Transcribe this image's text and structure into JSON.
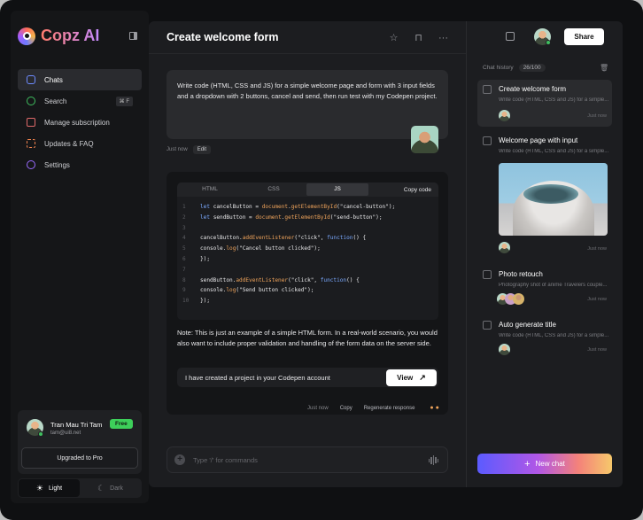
{
  "app": {
    "name": "Copz AI"
  },
  "nav": [
    {
      "label": "Chats",
      "icon": "chat-icon",
      "color": "#6d8bff"
    },
    {
      "label": "Search",
      "icon": "search-icon",
      "color": "#3fbf5f",
      "shortcut": "⌘ F"
    },
    {
      "label": "Manage subscription",
      "icon": "card-icon",
      "color": "#e06a6a"
    },
    {
      "label": "Updates & FAQ",
      "icon": "bulb-icon",
      "color": "#f0834e"
    },
    {
      "label": "Settings",
      "icon": "gear-icon",
      "color": "#9a6bff"
    }
  ],
  "user": {
    "name": "Tran Mau Tri Tam",
    "email": "tam@ui8.net",
    "plan": "Free",
    "upgrade_label": "Upgraded to Pro"
  },
  "theme": {
    "light": "Light",
    "dark": "Dark"
  },
  "chat": {
    "title": "Create welcome form",
    "prompt": "Write code (HTML, CSS and JS) for a simple welcome page and form with 3 input fields and a dropdown with 2 buttons, cancel and send, then run test with my Codepen project.",
    "prompt_time": "Just now",
    "edit_label": "Edit",
    "tabs": [
      "HTML",
      "CSS",
      "JS"
    ],
    "copy_code": "Copy code",
    "note": "Note: This is just an example of a simple HTML form. In a real-world scenario, you would also want to include proper validation and handling of the form data on the server side.",
    "project_text": "I have created a project in your Codepen account",
    "view_label": "View",
    "answer_time": "Just now",
    "copy_label": "Copy",
    "regen_label": "Regenerate response",
    "input_placeholder": "Type '/' for commands"
  },
  "code_lines": [
    {
      "n": "1",
      "parts": [
        [
          "kw",
          "let "
        ],
        [
          "tx",
          "cancelButton = "
        ],
        [
          "fn",
          "document"
        ],
        [
          "tx",
          "."
        ],
        [
          "fn",
          "getElementById"
        ],
        [
          "tx",
          "(\"cancel-button\");"
        ]
      ]
    },
    {
      "n": "2",
      "parts": [
        [
          "kw",
          "let "
        ],
        [
          "tx",
          "sendButton = "
        ],
        [
          "fn",
          "document"
        ],
        [
          "tx",
          "."
        ],
        [
          "fn",
          "getElementById"
        ],
        [
          "tx",
          "(\"send-button\");"
        ]
      ]
    },
    {
      "n": "3",
      "parts": []
    },
    {
      "n": "4",
      "parts": [
        [
          "tx",
          "cancelButton."
        ],
        [
          "fn",
          "addEventListener"
        ],
        [
          "tx",
          "(\"click\", "
        ],
        [
          "kw",
          "function"
        ],
        [
          "tx",
          "() {"
        ]
      ]
    },
    {
      "n": "5",
      "parts": [
        [
          "tx",
          "console."
        ],
        [
          "fn",
          "log"
        ],
        [
          "tx",
          "(\"Cancel button clicked\");"
        ]
      ]
    },
    {
      "n": "6",
      "parts": [
        [
          "tx",
          "});"
        ]
      ]
    },
    {
      "n": "7",
      "parts": []
    },
    {
      "n": "8",
      "parts": [
        [
          "tx",
          "sendButton."
        ],
        [
          "fn",
          "addEventListener"
        ],
        [
          "tx",
          "(\"click\", "
        ],
        [
          "kw",
          "function"
        ],
        [
          "tx",
          "() {"
        ]
      ]
    },
    {
      "n": "9",
      "parts": [
        [
          "tx",
          "console."
        ],
        [
          "fn",
          "log"
        ],
        [
          "tx",
          "(\"Send button clicked\");"
        ]
      ]
    },
    {
      "n": "10",
      "parts": [
        [
          "tx",
          "});"
        ]
      ]
    }
  ],
  "right": {
    "share_label": "Share",
    "history_label": "Chat history",
    "history_count": "26/100",
    "new_chat_label": "New chat"
  },
  "history": [
    {
      "title": "Create welcome form",
      "sub": "Write code (HTML, CSS and JS) for a simple...",
      "time": "Just now"
    },
    {
      "title": "Welcome page with input",
      "sub": "Write code (HTML, CSS and JS) for a simple...",
      "time": "Just now"
    },
    {
      "title": "Photo retouch",
      "sub": "Photography shot of anime Travelers couple...",
      "time": "Just now"
    },
    {
      "title": "Auto generate title",
      "sub": "Write code (HTML, CSS and JS) for a simple...",
      "time": "Just now"
    }
  ]
}
